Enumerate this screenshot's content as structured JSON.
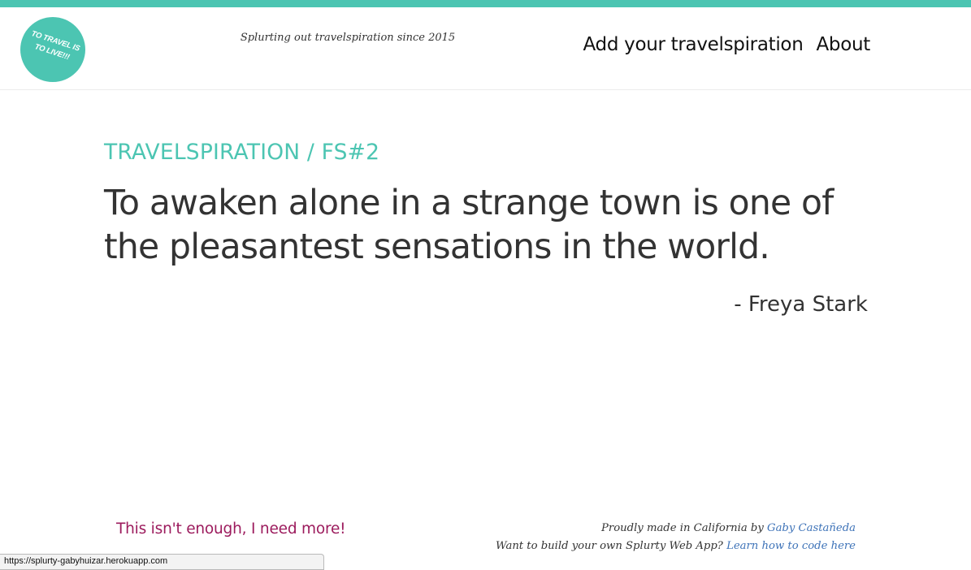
{
  "header": {
    "logo_text": "TO TRAVEL IS TO LIVE!!!",
    "tagline": "Splurting out travelspiration since 2015",
    "nav": [
      {
        "label": "Add your travelspiration"
      },
      {
        "label": "About"
      }
    ]
  },
  "main": {
    "kicker": "TRAVELSPIRATION / FS#2",
    "quote": "To awaken alone in a strange town is one of the pleasantest sensations in the world.",
    "author": "- Freya Stark"
  },
  "footer": {
    "more_link": "This isn't enough, I need more!",
    "credits_line1_prefix": "Proudly made in California by",
    "credits_line1_link": "Gaby Castañeda",
    "credits_line2_prefix": "Want to build your own Splurty Web App?",
    "credits_line2_link": "Learn how to code here"
  },
  "status_bar": {
    "url": "https://splurty-gabyhuizar.herokuapp.com"
  },
  "colors": {
    "accent": "#4cc5b2",
    "more_link": "#9c1b5d",
    "credit_link": "#3e73b8",
    "text": "#333333"
  }
}
